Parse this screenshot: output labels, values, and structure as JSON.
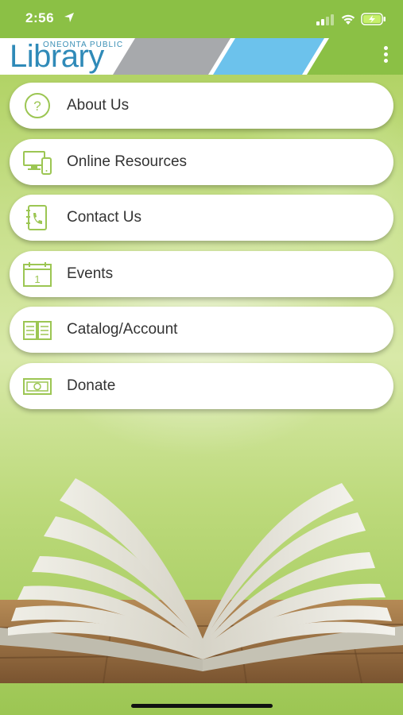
{
  "status_bar": {
    "time": "2:56"
  },
  "header": {
    "logo_small": "ONEONTA PUBLIC",
    "logo_big": "Library"
  },
  "menu": [
    {
      "label": "About Us",
      "icon": "question-icon"
    },
    {
      "label": "Online Resources",
      "icon": "devices-icon"
    },
    {
      "label": "Contact Us",
      "icon": "phone-book-icon"
    },
    {
      "label": "Events",
      "icon": "calendar-icon"
    },
    {
      "label": "Catalog/Account",
      "icon": "book-icon"
    },
    {
      "label": "Donate",
      "icon": "money-icon"
    }
  ],
  "colors": {
    "brand_green": "#8bc045",
    "brand_blue": "#2f8ab8",
    "icon_green": "#9cc653"
  }
}
